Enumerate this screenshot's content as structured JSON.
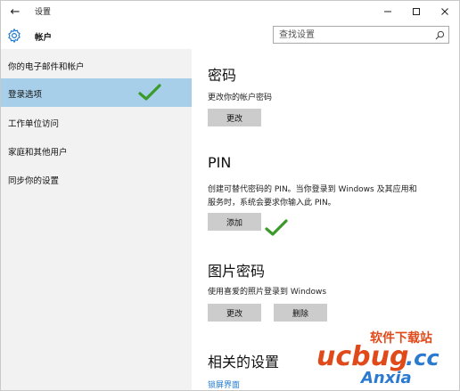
{
  "window": {
    "back_glyph": "←",
    "app_title": "设置",
    "controls": {
      "minimize": "—",
      "maximize": "☐",
      "close": "✕"
    }
  },
  "header": {
    "page_title": "帐户",
    "search_placeholder": "查找设置"
  },
  "sidebar": {
    "items": [
      {
        "label": "你的电子邮件和帐户",
        "active": false
      },
      {
        "label": "登录选项",
        "active": true
      },
      {
        "label": "工作单位访问",
        "active": false
      },
      {
        "label": "家庭和其他用户",
        "active": false
      },
      {
        "label": "同步你的设置",
        "active": false
      }
    ]
  },
  "content": {
    "password": {
      "title": "密码",
      "desc": "更改你的帐户密码",
      "button": "更改"
    },
    "pin": {
      "title": "PIN",
      "desc_line1": "创建可替代密码的 PIN。当你登录到 Windows 及其应用和",
      "desc_line2": "服务时，系统会要求你输入此 PIN。",
      "button": "添加"
    },
    "picture_password": {
      "title": "图片密码",
      "desc": "使用喜爱的照片登录到 Windows",
      "change_button": "更改",
      "remove_button": "删除"
    },
    "related": {
      "title": "相关的设置",
      "link": "锁屏界面"
    }
  },
  "watermark": {
    "brand": "ucbug",
    "domain": ".cc",
    "tagline": "软件下载站",
    "sub": "Anxia"
  },
  "colors": {
    "sidebar_bg": "#f2f2f2",
    "active_item": "#a8cfe9",
    "button_bg": "#cccccc",
    "link": "#1f7ad1",
    "check": "#3a9a2a"
  }
}
